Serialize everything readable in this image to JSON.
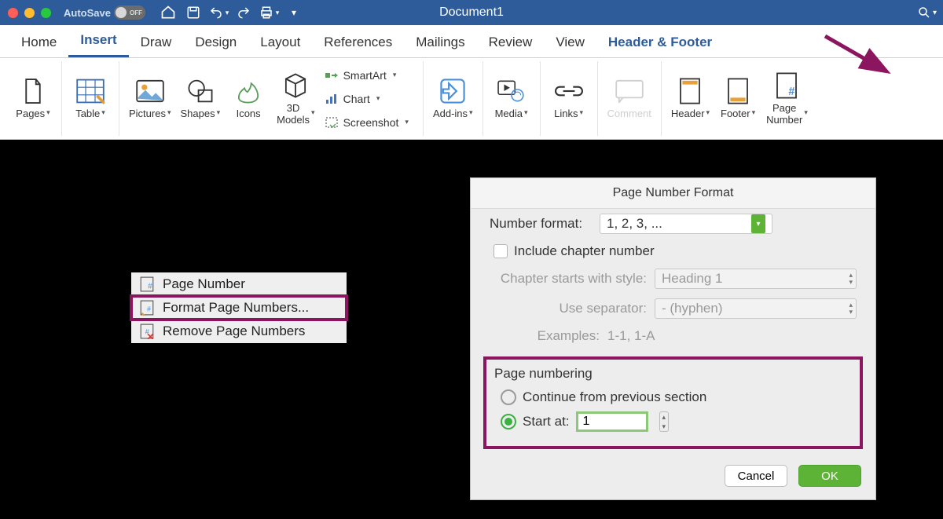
{
  "title": "Document1",
  "autosave": {
    "label": "AutoSave",
    "state": "OFF"
  },
  "tabs": [
    "Home",
    "Insert",
    "Draw",
    "Design",
    "Layout",
    "References",
    "Mailings",
    "Review",
    "View",
    "Header & Footer"
  ],
  "active_tab": "Insert",
  "ribbon": {
    "pages": "Pages",
    "table": "Table",
    "pictures": "Pictures",
    "shapes": "Shapes",
    "icons": "Icons",
    "models3d": "3D\nModels",
    "smartart": "SmartArt",
    "chart": "Chart",
    "screenshot": "Screenshot",
    "addins": "Add-ins",
    "media": "Media",
    "links": "Links",
    "comment": "Comment",
    "header": "Header",
    "footer": "Footer",
    "page_number": "Page\nNumber"
  },
  "context_menu": {
    "page_number": "Page Number",
    "format_page_numbers": "Format Page Numbers...",
    "remove_page_numbers": "Remove Page Numbers"
  },
  "dialog": {
    "title": "Page Number Format",
    "number_format_label": "Number format:",
    "number_format_value": "1, 2, 3, ...",
    "include_chapter_label": "Include chapter number",
    "chapter_style_label": "Chapter starts with style:",
    "chapter_style_value": "Heading 1",
    "separator_label": "Use separator:",
    "separator_value": "-    (hyphen)",
    "examples_label": "Examples:",
    "examples_value": "1-1, 1-A",
    "section_title": "Page numbering",
    "continue_label": "Continue from previous section",
    "start_at_label": "Start at:",
    "start_at_value": "1",
    "cancel": "Cancel",
    "ok": "OK"
  }
}
